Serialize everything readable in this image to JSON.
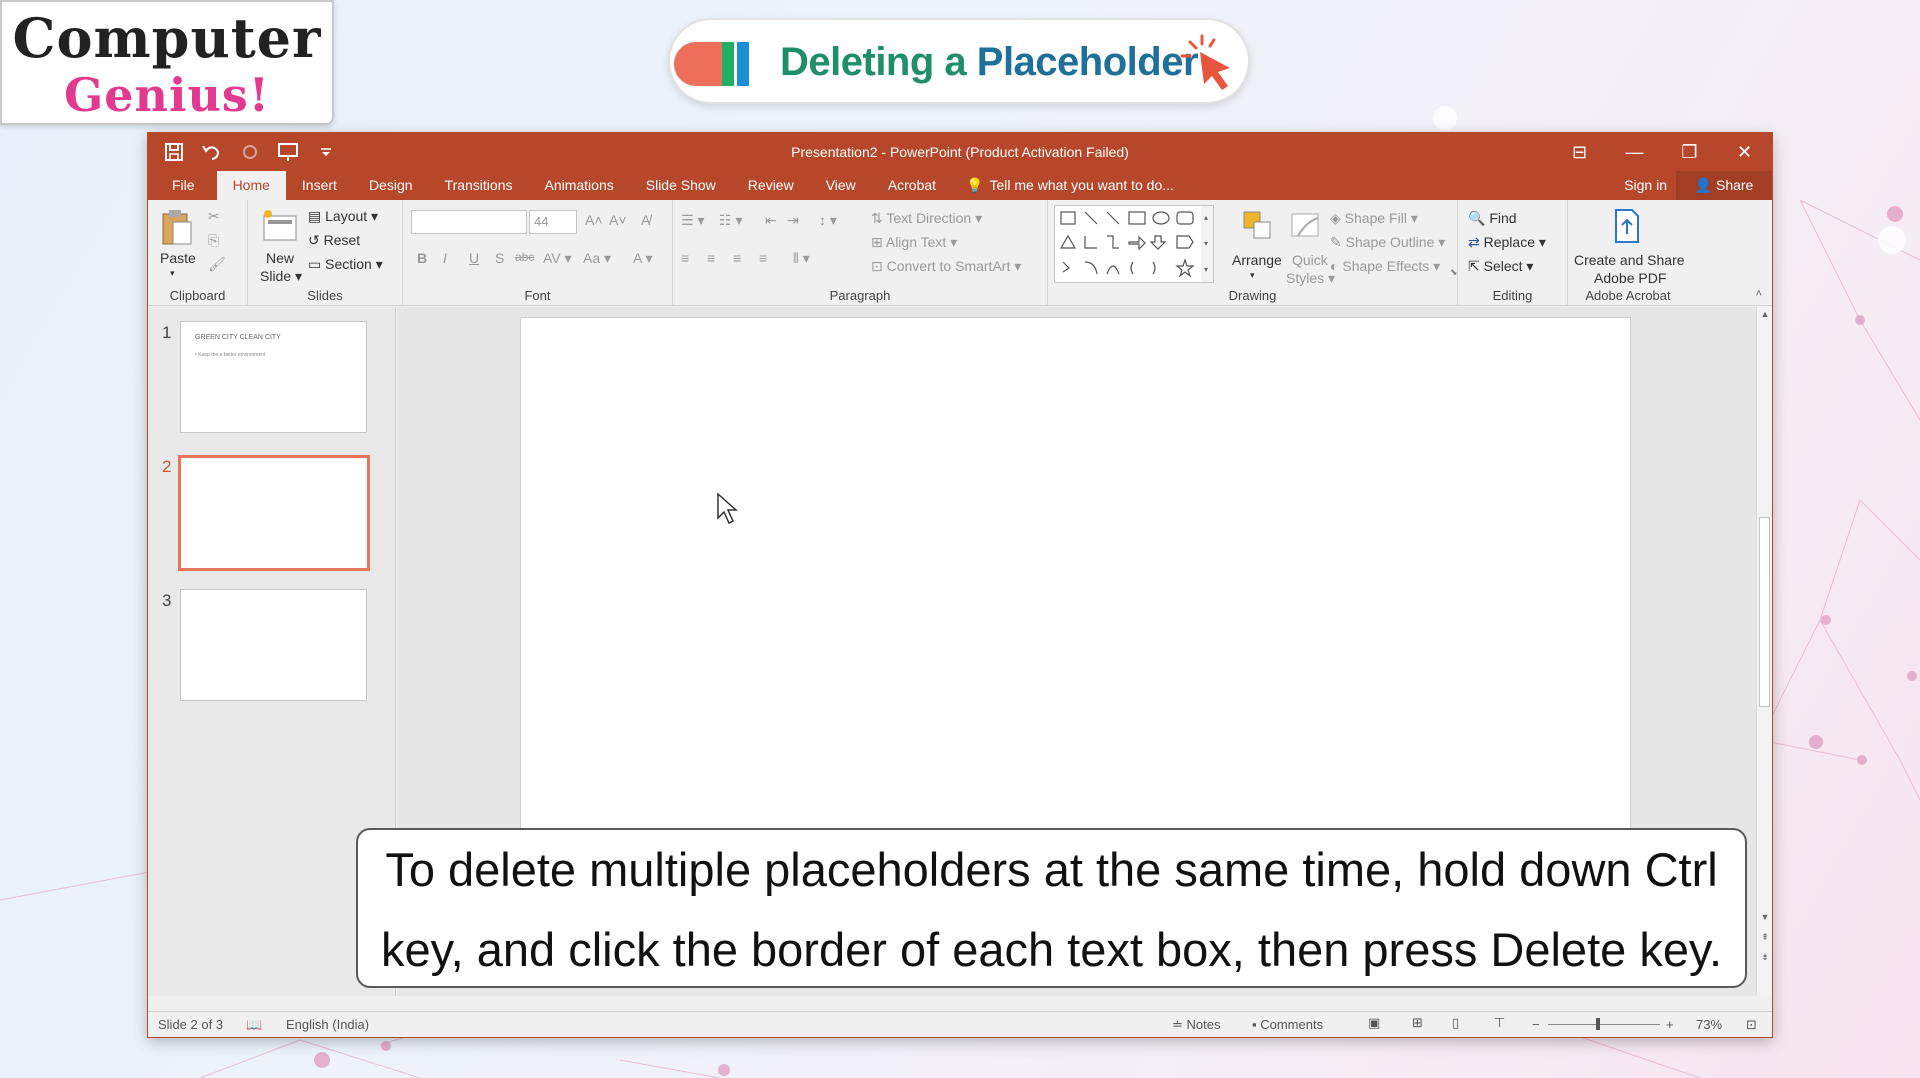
{
  "logo": {
    "line1": "Computer",
    "line2": "Genius!"
  },
  "banner": {
    "title_part1": "Deleting a ",
    "title_part2": "Placeholder"
  },
  "window": {
    "title": "Presentation2 - PowerPoint (Product Activation Failed)"
  },
  "tabs": [
    "File",
    "Home",
    "Insert",
    "Design",
    "Transitions",
    "Animations",
    "Slide Show",
    "Review",
    "View",
    "Acrobat"
  ],
  "active_tab": "Home",
  "tell_me": "Tell me what you want to do...",
  "account": {
    "sign_in": "Sign in",
    "share": "Share"
  },
  "ribbon": {
    "clipboard": {
      "label": "Clipboard",
      "paste": "Paste"
    },
    "slides": {
      "label": "Slides",
      "new_slide_1": "New",
      "new_slide_2": "Slide",
      "layout": "Layout",
      "reset": "Reset",
      "section": "Section"
    },
    "font": {
      "label": "Font",
      "font_size": "44"
    },
    "paragraph": {
      "label": "Paragraph",
      "text_direction": "Text Direction",
      "align_text": "Align Text",
      "convert_smartart": "Convert to SmartArt"
    },
    "drawing": {
      "label": "Drawing",
      "arrange": "Arrange",
      "quick_styles_1": "Quick",
      "quick_styles_2": "Styles",
      "shape_fill": "Shape Fill",
      "shape_outline": "Shape Outline",
      "shape_effects": "Shape Effects"
    },
    "editing": {
      "label": "Editing",
      "find": "Find",
      "replace": "Replace",
      "select": "Select"
    },
    "acrobat": {
      "label": "Adobe Acrobat",
      "create_share_1": "Create and Share",
      "create_share_2": "Adobe PDF"
    }
  },
  "slides": [
    {
      "number": "1",
      "title": "GREEN CITY CLEAN CITY",
      "bullet": "• Keep the a better environment"
    },
    {
      "number": "2"
    },
    {
      "number": "3"
    }
  ],
  "selected_slide": 2,
  "status": {
    "slide_info": "Slide 2 of 3",
    "language": "English (India)",
    "notes": "Notes",
    "comments": "Comments",
    "zoom": "73%"
  },
  "caption": {
    "text": "To delete multiple placeholders at the same time, hold down Ctrl key, and click the border of each text box, then press Delete key."
  },
  "colors": {
    "ppt_accent": "#b7472a",
    "selected_thumb": "#e8745a",
    "banner_title": "#1f6f9b"
  }
}
